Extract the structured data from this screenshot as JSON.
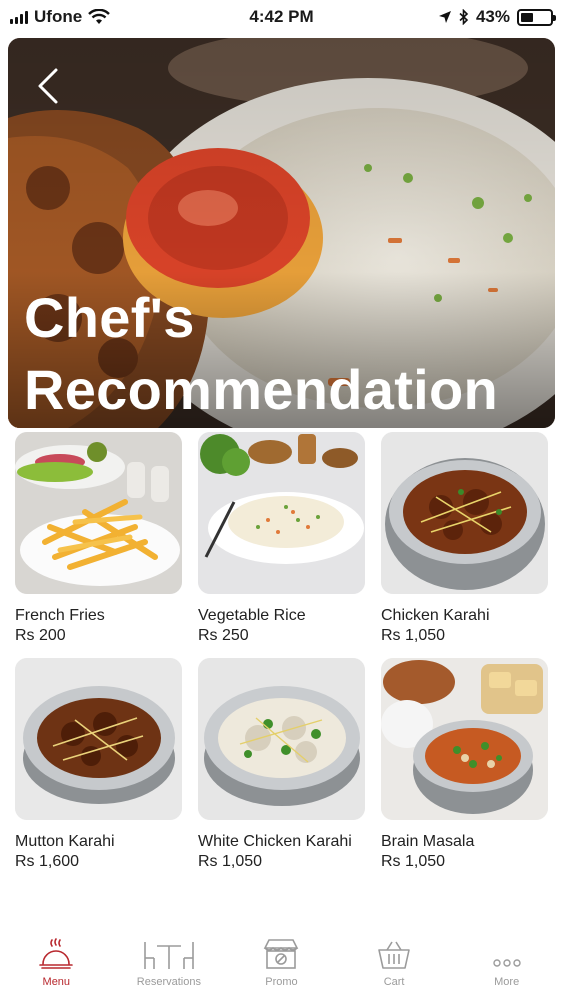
{
  "status_bar": {
    "carrier": "Ufone",
    "time": "4:42 PM",
    "battery": "43%",
    "battery_level": 0.43
  },
  "header": {
    "back_icon": "chevron-left-icon",
    "title_line1": "Chef's",
    "title_line2": "Recommendation"
  },
  "items": [
    {
      "name": "French Fries",
      "price": "Rs 200"
    },
    {
      "name": "Vegetable Rice",
      "price": "Rs 250"
    },
    {
      "name": "Chicken Karahi",
      "price": "Rs 1,050"
    },
    {
      "name": "Mutton Karahi",
      "price": "Rs 1,600"
    },
    {
      "name": "White Chicken Karahi",
      "price": "Rs 1,050"
    },
    {
      "name": "Brain Masala",
      "price": "Rs 1,050"
    }
  ],
  "tabbar": {
    "active_color": "#b8282e",
    "inactive_color": "#9b9b9b",
    "tabs": [
      {
        "label": "Menu",
        "icon": "cloche-icon",
        "active": true
      },
      {
        "label": "Reservations",
        "icon": "table-chairs-icon",
        "active": false
      },
      {
        "label": "Promo",
        "icon": "promo-store-icon",
        "active": false
      },
      {
        "label": "Cart",
        "icon": "basket-icon",
        "active": false
      },
      {
        "label": "More",
        "icon": "more-dots-icon",
        "active": false
      }
    ]
  }
}
